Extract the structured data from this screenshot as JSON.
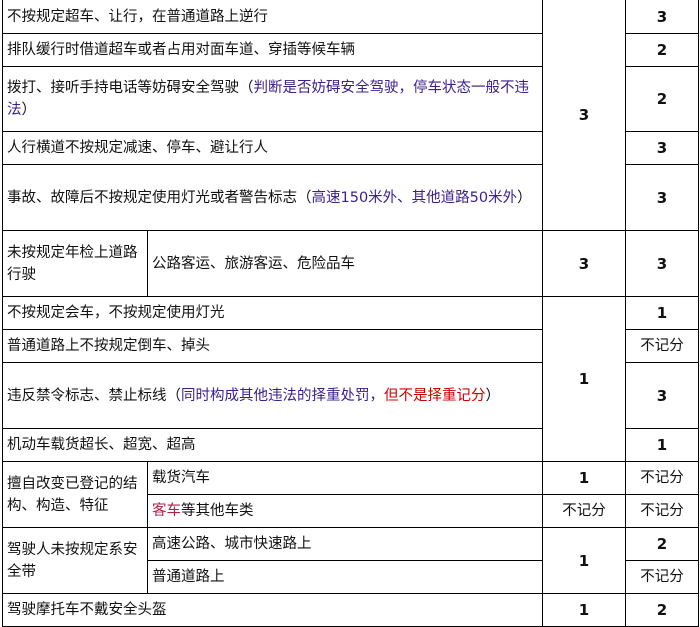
{
  "rows": [
    {
      "desc": "不按规定超车、让行，在普通道路上逆行",
      "points": "3"
    },
    {
      "desc": "排队缓行时借道超车或者占用对面车道、穿插等候车辆",
      "points": "2"
    },
    {
      "desc": "拨打、接听手持电话等妨碍安全驾驶（",
      "note": "判断是否妨碍安全驾驶，停车状态一般不违法",
      "tail": "）",
      "points": "2"
    },
    {
      "desc": "人行横道不按规定减速、停车、避让行人",
      "points": "3"
    },
    {
      "desc": "事故、故障后不按规定使用灯光或者警告标志（",
      "note": "高速150米外、其他道路50米外",
      "tail": "）",
      "points": "3"
    },
    {
      "category": "未按规定年检上道路行驶",
      "desc": "公路客运、旅游客运、危险品车",
      "old": "3",
      "points": "3"
    },
    {
      "desc": "不按规定会车，不按规定使用灯光",
      "points": "1"
    },
    {
      "desc": "普通道路上不按规定倒车、掉头",
      "points": "不记分"
    },
    {
      "desc": "违反禁令标志、禁止标线（",
      "note": "同时构成其他违法的择重处罚，",
      "warn": "但不是择重记分",
      "tail": "）",
      "points": "3"
    },
    {
      "desc": "机动车载货超长、超宽、超高",
      "points": "1"
    },
    {
      "category": "擅自改变已登记的结构、构造、特征",
      "desc": "载货汽车",
      "old": "1",
      "points": "不记分"
    },
    {
      "desc_highlight": "客车",
      "desc": "等其他车类",
      "old": "不记分",
      "points": "不记分"
    },
    {
      "category": "驾驶人未按规定系安全带",
      "desc": "高速公路、城市快速路上",
      "points": "2"
    },
    {
      "desc": "普通道路上",
      "points": "不记分"
    },
    {
      "desc": "驾驶摩托车不戴安全头盔",
      "old": "1",
      "points": "2"
    }
  ],
  "group_old": {
    "a": "3",
    "b": "1",
    "c": "1"
  }
}
